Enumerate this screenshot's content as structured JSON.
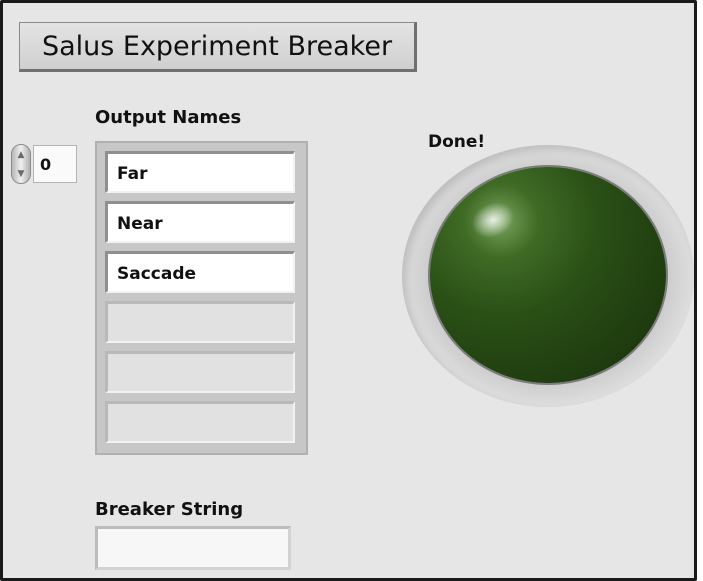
{
  "title_button": {
    "label": "Salus Experiment Breaker"
  },
  "output_names": {
    "label": "Output Names",
    "index_value": "0",
    "spinner": {
      "up_icon": "▲",
      "down_icon": "▼"
    },
    "items": [
      "Far",
      "Near",
      "Saccade",
      "",
      "",
      ""
    ]
  },
  "breaker_string": {
    "label": "Breaker String",
    "value": ""
  },
  "done_indicator": {
    "label": "Done!",
    "state": "off",
    "color": "#2a4f16"
  }
}
